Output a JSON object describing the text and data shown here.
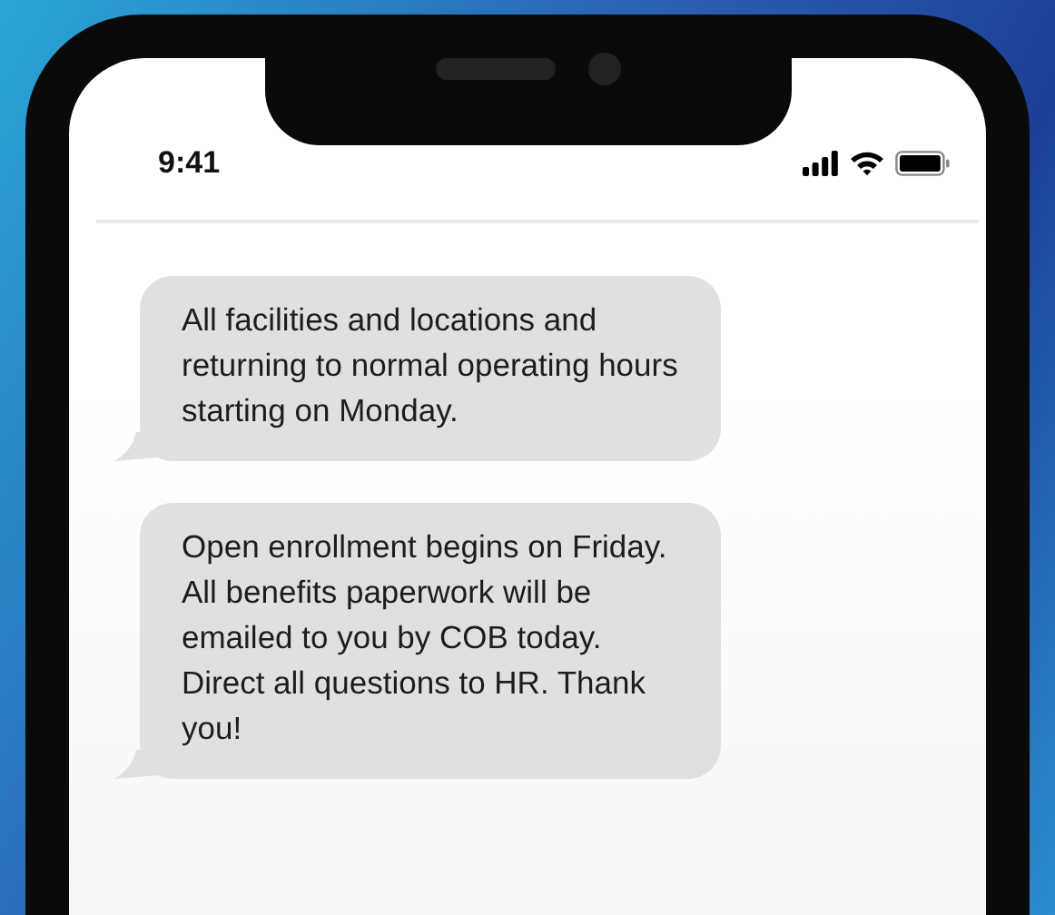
{
  "status_bar": {
    "time": "9:41"
  },
  "messages": [
    {
      "text": "All facilities and locations and returning to normal operating hours starting on Monday."
    },
    {
      "text": "Open enrollment begins on Friday. All benefits paperwork will be emailed to you by COB today. Direct all questions to HR. Thank you!"
    }
  ]
}
